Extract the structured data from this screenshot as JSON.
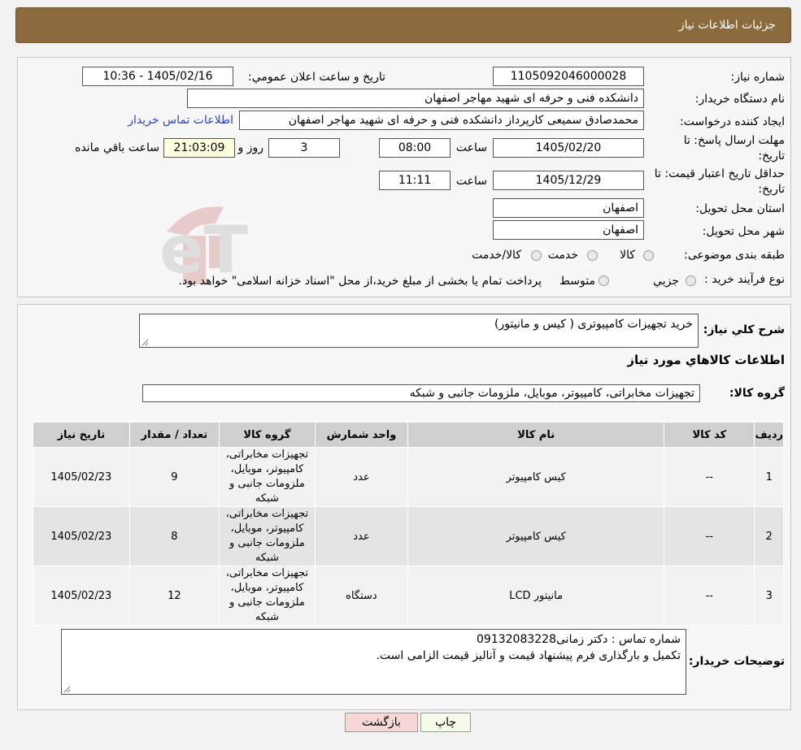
{
  "header": {
    "title": "جزئيات اطلاعات نياز"
  },
  "form": {
    "need_number": {
      "label": "شماره نياز:",
      "value": "1105092046000028"
    },
    "announce": {
      "label": "تاريخ و ساعت اعلان عمومي:",
      "value": "1405/02/16 - 10:36"
    },
    "buyer": {
      "label": "نام دستگاه خريدار:",
      "value": "دانشکده فنی و حرفه ای شهید مهاجر اصفهان"
    },
    "requester": {
      "label": "ايجاد کننده درخواست:",
      "value": "محمدصادق سمیعی کارپرداز دانشکده فنی و حرفه ای شهید مهاجر اصفهان",
      "contact_link": "اطلاعات تماس خريدار"
    },
    "deadline": {
      "label_line1": "مهلت ارسال پاسخ: تا",
      "label_line2": "تاريخ:",
      "date": "1405/02/20",
      "time_label": "ساعت",
      "time": "08:00",
      "days": "3",
      "days_label": "روز و",
      "remaining": "21:03:09",
      "remaining_label": "ساعت باقي مانده"
    },
    "validity": {
      "label_line1": "حداقل تاريخ اعتبار قيمت: تا",
      "label_line2": "تاريخ:",
      "date": "1405/12/29",
      "time_label": "ساعت",
      "time": "11:11"
    },
    "province": {
      "label": "استان محل تحويل:",
      "value": "اصفهان"
    },
    "city": {
      "label": "شهر محل تحويل:",
      "value": "اصفهان"
    },
    "category": {
      "label": "طبقه بندی موضوعی:",
      "options": [
        "کالا",
        "خدمت",
        "کالا/خدمت"
      ]
    },
    "process": {
      "label": "نوع فرآیند خرید :",
      "options": [
        "جزيي",
        "متوسط"
      ],
      "note": "پرداخت تمام يا بخشی از مبلغ خريد،از محل \"اسناد خزانه اسلامی\" خواهد بود."
    }
  },
  "summary": {
    "label": "شرح کلي نياز:",
    "value": "خرید تجهیزات کامپیوتری ( کیس و مانیتور)",
    "items_title": "اطلاعات کالاهاي مورد نياز",
    "group_label": "گروه کالا:",
    "group_value": "تجهیزات مخابراتی، کامپیوتر، موبایل، ملزومات جانبی و شبکه"
  },
  "table": {
    "headers": [
      "رديف",
      "کد کالا",
      "نام کالا",
      "واحد شمارش",
      "گروه کالا",
      "تعداد / مقدار",
      "تاريخ نياز"
    ],
    "rows": [
      {
        "idx": "1",
        "code": "--",
        "name": "کیس کامپیوتر",
        "unit": "عدد",
        "group": "تجهیزات مخابراتی، کامپیوتر، موبایل، ملزومات جانبی و شبکه",
        "qty": "9",
        "date": "1405/02/23"
      },
      {
        "idx": "2",
        "code": "--",
        "name": "کیس کامپیوتر",
        "unit": "عدد",
        "group": "تجهیزات مخابراتی، کامپیوتر، موبایل، ملزومات جانبی و شبکه",
        "qty": "8",
        "date": "1405/02/23"
      },
      {
        "idx": "3",
        "code": "--",
        "name": "مانیتور LCD",
        "unit": "دستگاه",
        "group": "تجهیزات مخابراتی، کامپیوتر، موبایل، ملزومات جانبی و شبکه",
        "qty": "12",
        "date": "1405/02/23"
      }
    ]
  },
  "buyer_notes": {
    "label": "توضيحات خريدار:",
    "line1": "شماره تماس : دکتر زمانی09132083228",
    "line2": "تکمیل و بارگذاری فرم پیشنهاد قیمت و آنالیز قیمت الزامی است."
  },
  "buttons": {
    "print": "چاپ",
    "back": "بازگشت"
  },
  "watermark": {
    "text": "AriaTender.neT"
  },
  "colors": {
    "header": "#8b6a3e",
    "link": "#2a3ed6",
    "back_button": "#f8d7d7",
    "print_button": "#f4fbe9"
  }
}
